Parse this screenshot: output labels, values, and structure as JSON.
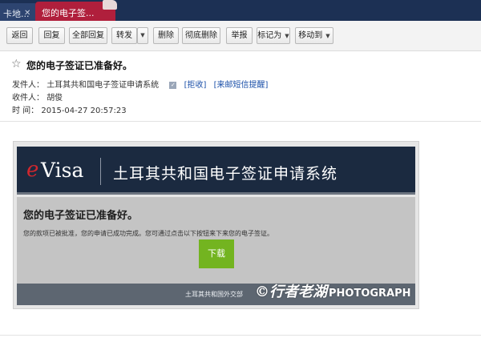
{
  "tabs": [
    {
      "label": "卡地...",
      "close": "✕"
    },
    {
      "label": "您的电子签...",
      "close": "✕"
    }
  ],
  "toolbar": {
    "back": "返回",
    "reply": "回复",
    "reply_all": "全部回复",
    "forward": "转发",
    "delete": "删除",
    "delete_permanently": "彻底删除",
    "report": "举报",
    "mark_as": "标记为",
    "move_to": "移动到"
  },
  "message": {
    "subject": "您的电子签证已准备好。",
    "sender_label": "发件人：",
    "sender_name": "土耳其共和国电子签证申请系统",
    "reject_link": "[拒收]",
    "sms_link": "[来邮短信提醒]",
    "recipient_label": "收件人：",
    "recipient_name": "胡俊",
    "time_label": "时    间：",
    "time_value": "2015-04-27 20:57:23"
  },
  "email_body": {
    "logo_e": "e",
    "logo_visa": "Visa",
    "banner_title": "土耳其共和国电子签证申请系统",
    "heading": "您的电子签证已准备好。",
    "text": "您的款项已被批准，您的申请已成功完成。您可通过点击以下按钮来下来您的电子签证。",
    "download_button": "下载",
    "footer": "土耳其共和国外交部"
  },
  "watermark": {
    "text": "©行者老湖",
    "latin": "PHOTOGRAPH"
  },
  "colors": {
    "tab_bar": "#1c3054",
    "active_tab": "#b01f3c",
    "banner": "#1b2a40",
    "download_green": "#73b420",
    "link_blue": "#1a4fa8"
  },
  "icons": {
    "star": "star-icon",
    "verified": "verified-icon",
    "tab_close": "close-icon",
    "caret": "chevron-down-icon"
  }
}
